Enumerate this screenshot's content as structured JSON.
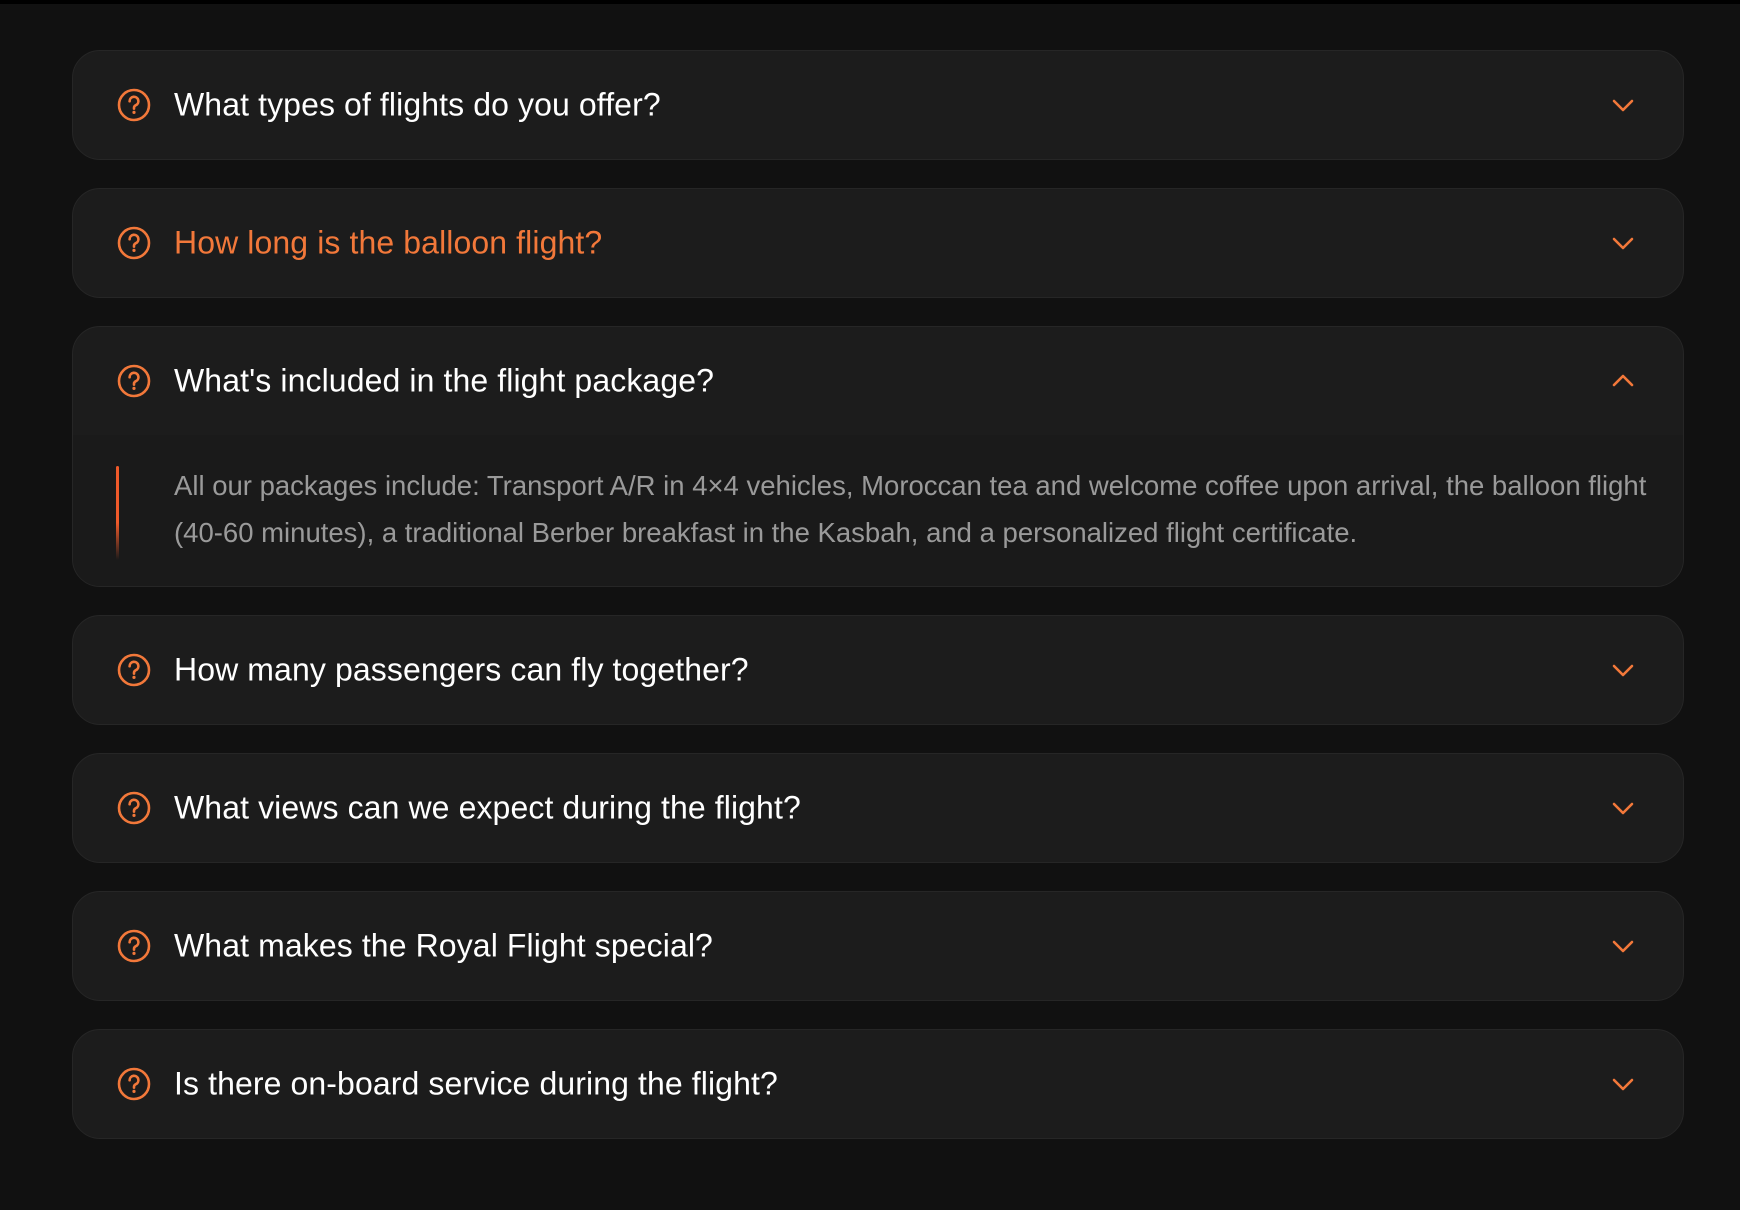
{
  "colors": {
    "background": "#111111",
    "card": "#1c1c1c",
    "accent": "#f2783a",
    "question_text": "#ffffff",
    "answer_text": "#9a9a9a"
  },
  "faq": {
    "items": [
      {
        "question": "What types of flights do you offer?",
        "state": "collapsed",
        "icon": "question-circle-icon",
        "toggle_icon": "chevron-down-icon"
      },
      {
        "question": "How long is the balloon flight?",
        "state": "hovered",
        "icon": "question-circle-icon",
        "toggle_icon": "chevron-down-icon"
      },
      {
        "question": "What's included in the flight package?",
        "state": "expanded",
        "icon": "question-circle-icon",
        "toggle_icon": "chevron-up-icon",
        "answer": "All our packages include: Transport A/R in 4×4 vehicles, Moroccan tea and welcome coffee upon arrival, the balloon flight (40-60 minutes), a traditional Berber breakfast in the Kasbah, and a personalized flight certificate."
      },
      {
        "question": "How many passengers can fly together?",
        "state": "collapsed",
        "icon": "question-circle-icon",
        "toggle_icon": "chevron-down-icon"
      },
      {
        "question": "What views can we expect during the flight?",
        "state": "collapsed",
        "icon": "question-circle-icon",
        "toggle_icon": "chevron-down-icon"
      },
      {
        "question": "What makes the Royal Flight special?",
        "state": "collapsed",
        "icon": "question-circle-icon",
        "toggle_icon": "chevron-down-icon"
      },
      {
        "question": "Is there on-board service during the flight?",
        "state": "collapsed",
        "icon": "question-circle-icon",
        "toggle_icon": "chevron-down-icon"
      }
    ]
  }
}
